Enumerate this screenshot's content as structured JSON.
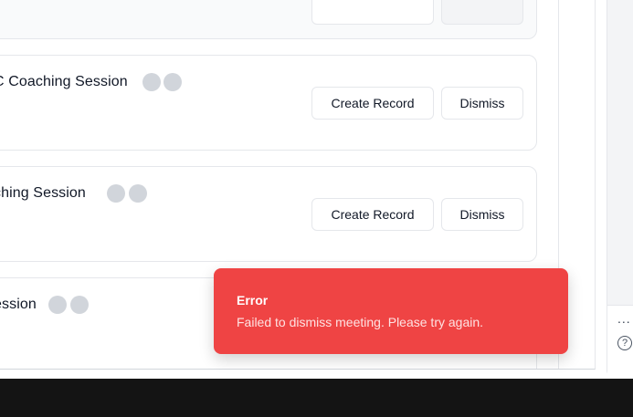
{
  "meetings": [
    {
      "title": "",
      "create_label": "",
      "dismiss_label": ""
    },
    {
      "title": "C Coaching Session",
      "create_label": "Create Record",
      "dismiss_label": "Dismiss"
    },
    {
      "title": "ching Session",
      "create_label": "Create Record",
      "dismiss_label": "Dismiss"
    },
    {
      "title": "ession"
    }
  ],
  "rail": {
    "more_label": "...",
    "help_label": "?"
  },
  "toast": {
    "title": "Error",
    "message": "Failed to dismiss meeting. Please try again."
  },
  "colors": {
    "toast_bg": "#ef4444",
    "avatar_placeholder": "#d1d5db",
    "border": "#e5e7eb"
  }
}
